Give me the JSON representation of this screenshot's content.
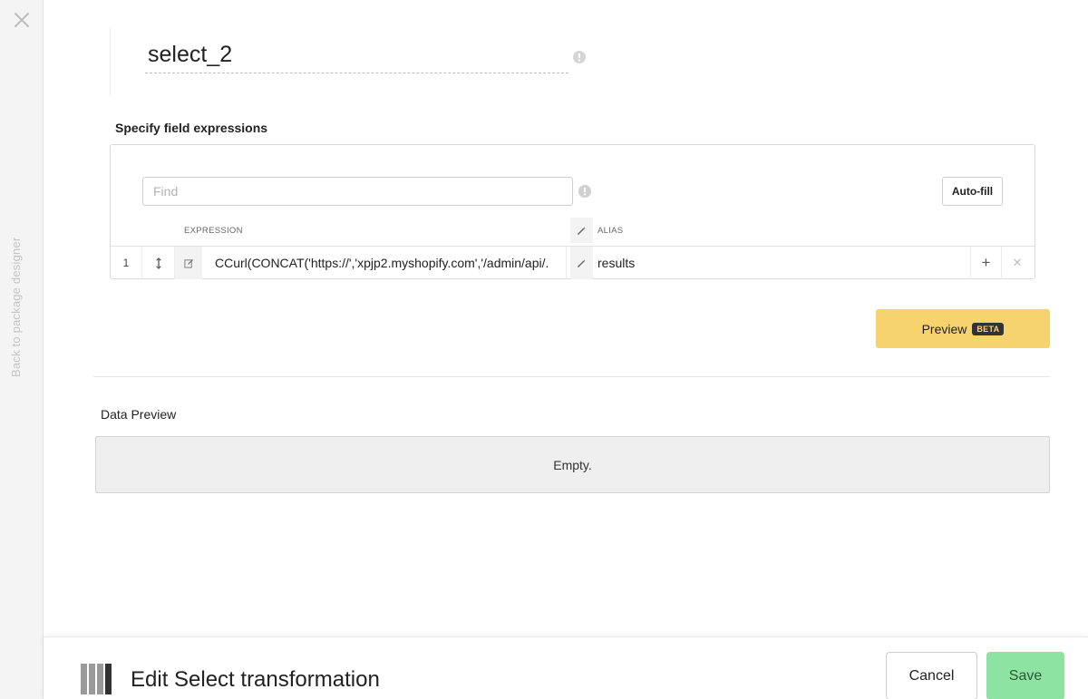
{
  "sidebar": {
    "close_icon": "close-icon",
    "back_label": "Back to package designer"
  },
  "component": {
    "name": "select_2"
  },
  "expressions": {
    "section_label": "Specify field expressions",
    "find_placeholder": "Find",
    "autofill_label": "Auto-fill",
    "headers": {
      "expression": "EXPRESSION",
      "alias": "ALIAS"
    },
    "rows": [
      {
        "index": "1",
        "expression": "CCurl(CONCAT('https://','xpjp2.myshopify.com','/admin/api/.",
        "alias": "results"
      }
    ]
  },
  "preview": {
    "button_label": "Preview",
    "badge": "BETA"
  },
  "data_preview": {
    "label": "Data Preview",
    "empty_text": "Empty."
  },
  "footer": {
    "title": "Edit Select transformation",
    "cancel_label": "Cancel",
    "save_label": "Save"
  },
  "colors": {
    "preview_button": "#f7d36f",
    "save_button": "#8de3a1",
    "rail_background": "#f4f4f4"
  }
}
